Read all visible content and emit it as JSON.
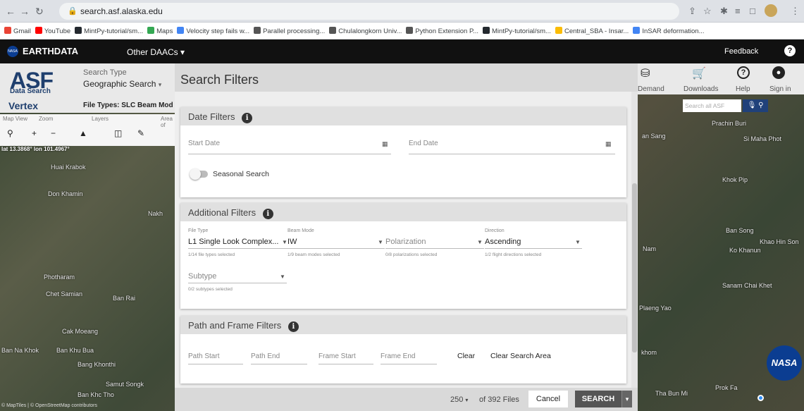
{
  "browser": {
    "url": "search.asf.alaska.edu",
    "bookmarks": [
      {
        "label": "Gmail",
        "color": "#ea4335"
      },
      {
        "label": "YouTube",
        "color": "#ff0000"
      },
      {
        "label": "MintPy-tutorial/sm...",
        "color": "#24292f"
      },
      {
        "label": "Maps",
        "color": "#34a853"
      },
      {
        "label": "Velocity step fails w...",
        "color": "#4285f4"
      },
      {
        "label": "Parallel processing...",
        "color": "#555555"
      },
      {
        "label": "Chulalongkorn Univ...",
        "color": "#555555"
      },
      {
        "label": "Python Extension P...",
        "color": "#555555"
      },
      {
        "label": "MintPy-tutorial/sm...",
        "color": "#24292f"
      },
      {
        "label": "Central_SBA - Insar...",
        "color": "#fbbc04"
      },
      {
        "label": "InSAR deformation...",
        "color": "#4285f4"
      }
    ]
  },
  "earthdata": {
    "logo_text": "EARTHDATA",
    "nasa": "NASA",
    "daacs": "Other DAACs",
    "feedback": "Feedback",
    "help": "?"
  },
  "vertex": {
    "asf": "ASF",
    "data_search": "Data Search",
    "name": "Vertex",
    "search_type_label": "Search Type",
    "search_type_value": "Geographic Search",
    "file_types": "File Types: SLC Beam Mod",
    "maptools": [
      "Map View",
      "Zoom",
      "Layers",
      "Area of"
    ],
    "latlon": "lat 13.3868°  lon 101.4967°"
  },
  "map_labels": [
    "Huai Krabok",
    "Don Khamin",
    "Nakh",
    "Photharam",
    "Chet Samian",
    "Ban Rai",
    "Cak Moeang",
    "Ban Na Khok",
    "Ban Khu Bua",
    "Bang Khonthi",
    "Samut Songk",
    "Ban Khc Tho",
    "Prachin Buri",
    "an Sang",
    "Si Maha Phot",
    "Khok Pip",
    "Ban Song",
    "Khao Hin Son",
    "Nam",
    "Ko Khanun",
    "Sanam Chai Khet",
    "Plaeng Yao",
    "khom",
    "Prok Fa",
    "Tha Bun Mi"
  ],
  "dialog": {
    "title": "Search Filters",
    "date": {
      "title": "Date Filters",
      "start_placeholder": "Start Date",
      "end_placeholder": "End Date",
      "seasonal": "Seasonal Search"
    },
    "additional": {
      "title": "Additional Filters",
      "file_type": {
        "label": "File Type",
        "value": "L1 Single Look Complex...",
        "hint": "1/14 file types selected"
      },
      "beam_mode": {
        "label": "Beam Mode",
        "value": "IW",
        "hint": "1/9 beam modes selected"
      },
      "polarization": {
        "placeholder": "Polarization",
        "hint": "0/8 polarizations selected"
      },
      "direction": {
        "label": "Direction",
        "value": "Ascending",
        "hint": "1/2 flight directions selected"
      },
      "subtype": {
        "placeholder": "Subtype",
        "hint": "0/2 subtypes selected"
      }
    },
    "path_frame": {
      "title": "Path and Frame Filters",
      "path_start": "Path Start",
      "path_end": "Path End",
      "frame_start": "Frame Start",
      "frame_end": "Frame End",
      "clear": "Clear",
      "clear_area": "Clear Search Area"
    },
    "footer": {
      "max_results": "250",
      "of_files": "of 392 Files",
      "cancel": "Cancel",
      "search": "SEARCH"
    }
  },
  "right_header": {
    "demand": "Demand",
    "downloads": "Downloads",
    "help": "Help",
    "sign_in": "Sign in",
    "search_placeholder": "Search all ASF"
  },
  "map_footer": "© MapTiles | © OpenStreetMap contributors",
  "nasa_badge": "NASA"
}
